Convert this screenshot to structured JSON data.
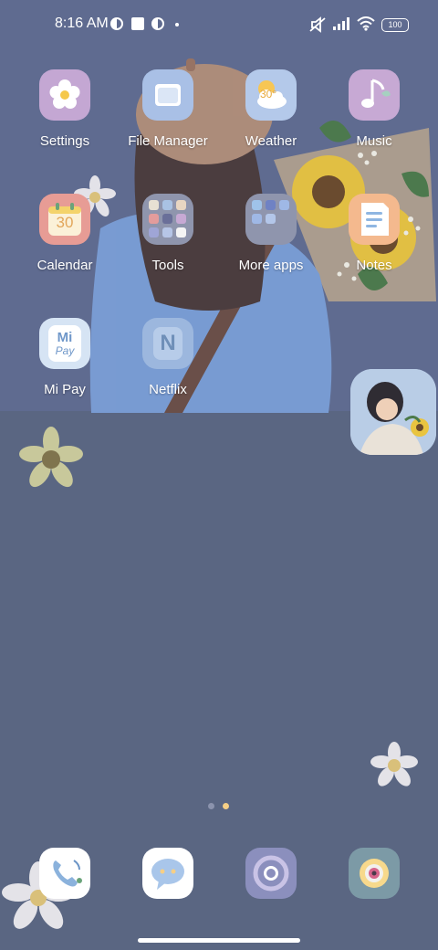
{
  "status_bar": {
    "time": "8:16 AM",
    "battery_level": "100",
    "icons": [
      "notification-icon",
      "square-notification-icon",
      "notification-icon",
      "dot-icon",
      "silent-mode-icon",
      "signal-icon",
      "wifi-icon",
      "battery-icon"
    ]
  },
  "apps": [
    {
      "label": "Settings",
      "icon": "settings-icon",
      "bg": "#c4a7d3"
    },
    {
      "label": "File Manager",
      "icon": "folder-icon",
      "bg": "#a9c0e6"
    },
    {
      "label": "Weather",
      "icon": "weather-icon",
      "bg": "#b4c9ea",
      "badge": "30°"
    },
    {
      "label": "Music",
      "icon": "music-icon",
      "bg": "#c7a9d4"
    },
    {
      "label": "Calendar",
      "icon": "calendar-icon",
      "bg": "#e79c95",
      "badge": "30"
    },
    {
      "label": "Tools",
      "icon": "folder-icon",
      "bg": "#8f95ad"
    },
    {
      "label": "More apps",
      "icon": "folder-icon",
      "bg": "#8f95ad"
    },
    {
      "label": "Notes",
      "icon": "notes-icon",
      "bg": "#f4b98e"
    },
    {
      "label": "Mi Pay",
      "icon": "mi-pay-icon",
      "bg": "#d6e4f4",
      "badge_top": "Mi",
      "badge_bottom": "Pay"
    },
    {
      "label": "Netflix",
      "icon": "netflix-icon",
      "bg": "#9cb7de",
      "badge": "N"
    }
  ],
  "dock": [
    {
      "icon": "phone-icon",
      "bg": "#ffffff"
    },
    {
      "icon": "messages-icon",
      "bg": "#ffffff"
    },
    {
      "icon": "chrome-icon",
      "bg": "#8b8fbd"
    },
    {
      "icon": "camera-icon",
      "bg": "#7c9aa6"
    }
  ],
  "page_indicator": {
    "current": 2,
    "total": 2
  }
}
